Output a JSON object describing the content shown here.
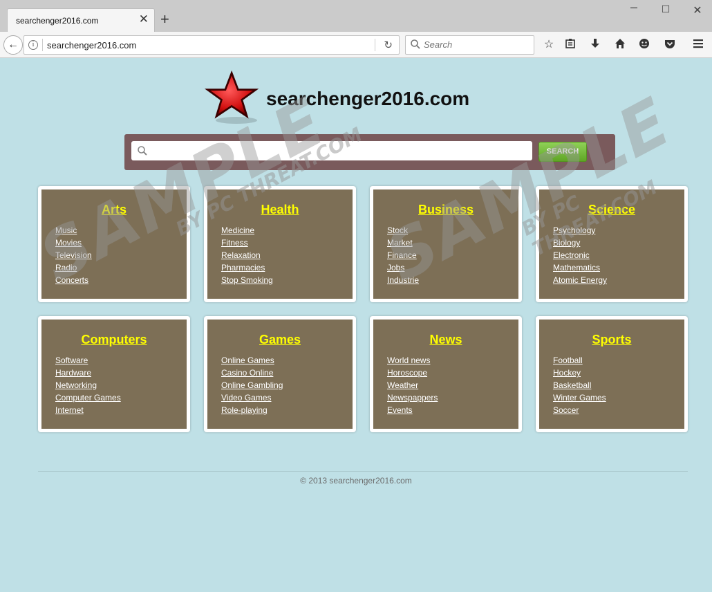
{
  "browser": {
    "tab_title": "searchenger2016.com",
    "url": "searchenger2016.com",
    "search_placeholder": "Search"
  },
  "site": {
    "title": "searchenger2016.com",
    "search_button": "SEARCH",
    "search_value": ""
  },
  "categories": [
    {
      "title": "Arts",
      "links": [
        "Music",
        "Movies",
        "Television",
        "Radio",
        "Concerts"
      ]
    },
    {
      "title": "Health",
      "links": [
        "Medicine",
        "Fitness",
        "Relaxation",
        "Pharmacies",
        "Stop Smoking"
      ]
    },
    {
      "title": "Business",
      "links": [
        "Stock",
        "Market",
        "Finance",
        "Jobs",
        "Industrie"
      ]
    },
    {
      "title": "Science",
      "links": [
        "Psychology",
        "Biology",
        "Electronic",
        "Mathematics",
        "Atomic Energy"
      ]
    },
    {
      "title": "Computers",
      "links": [
        "Software",
        "Hardware",
        "Networking",
        "Computer Games",
        "Internet"
      ]
    },
    {
      "title": "Games",
      "links": [
        "Online Games",
        "Casino Online",
        "Online Gambling",
        "Video Games",
        "Role-playing"
      ]
    },
    {
      "title": "News",
      "links": [
        "World news",
        "Horoscope",
        "Weather",
        "Newspappers",
        "Events"
      ]
    },
    {
      "title": "Sports",
      "links": [
        "Football",
        "Hockey",
        "Basketball",
        "Winter Games",
        "Soccer"
      ]
    }
  ],
  "footer": "© 2013 searchenger2016.com",
  "watermark": {
    "big": "SAMPLE",
    "small": "BY PC THREAT.COM"
  },
  "colors": {
    "page_bg": "#bfe0e6",
    "card_bg": "#7d6f56",
    "card_title": "#ffff00",
    "search_panel": "#7a5a5c",
    "search_button": "#6fb832"
  }
}
